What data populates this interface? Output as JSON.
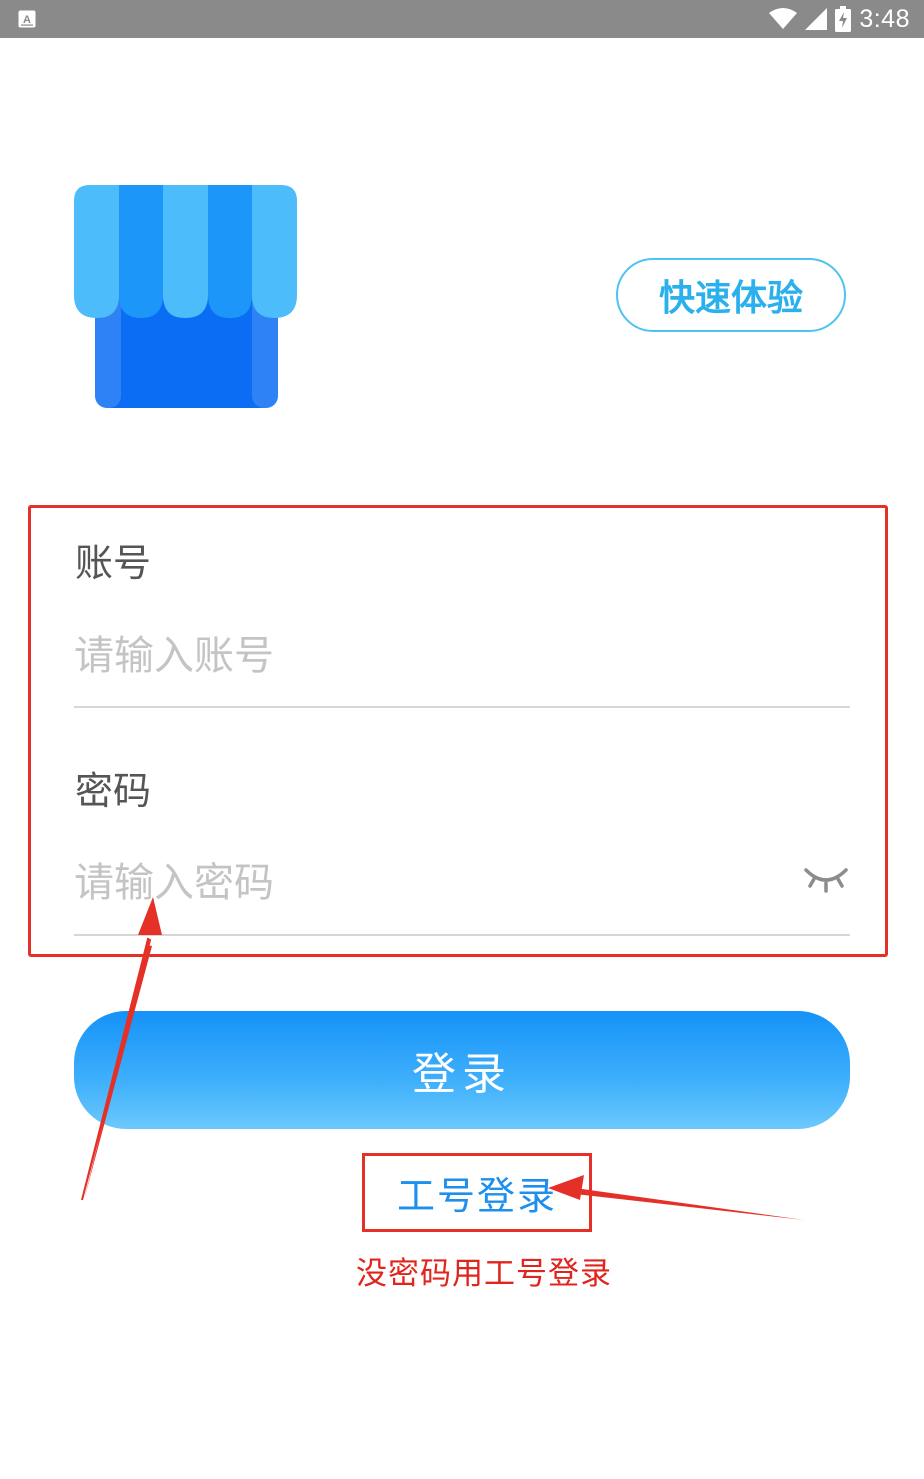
{
  "status_bar": {
    "time": "3:48",
    "notification_icon": "a-notification-icon",
    "wifi_icon": "wifi-icon",
    "signal_icon": "signal-icon",
    "battery_icon": "battery-charging-icon"
  },
  "header": {
    "logo_icon": "shop-awning-logo",
    "quick_trial_label": "快速体验"
  },
  "form": {
    "account_label": "账号",
    "account_placeholder": "请输入账号",
    "account_value": "",
    "password_label": "密码",
    "password_placeholder": "请输入密码",
    "password_value": "",
    "password_toggle_icon": "eye-closed-icon"
  },
  "actions": {
    "login_label": "登录",
    "employee_login_label": "工号登录"
  },
  "annotations": {
    "note": "没密码用工号登录",
    "color": "#e53027"
  },
  "colors": {
    "primary_blue": "#1592f8",
    "light_blue": "#4fc3f0",
    "link_blue": "#1f8fee"
  }
}
